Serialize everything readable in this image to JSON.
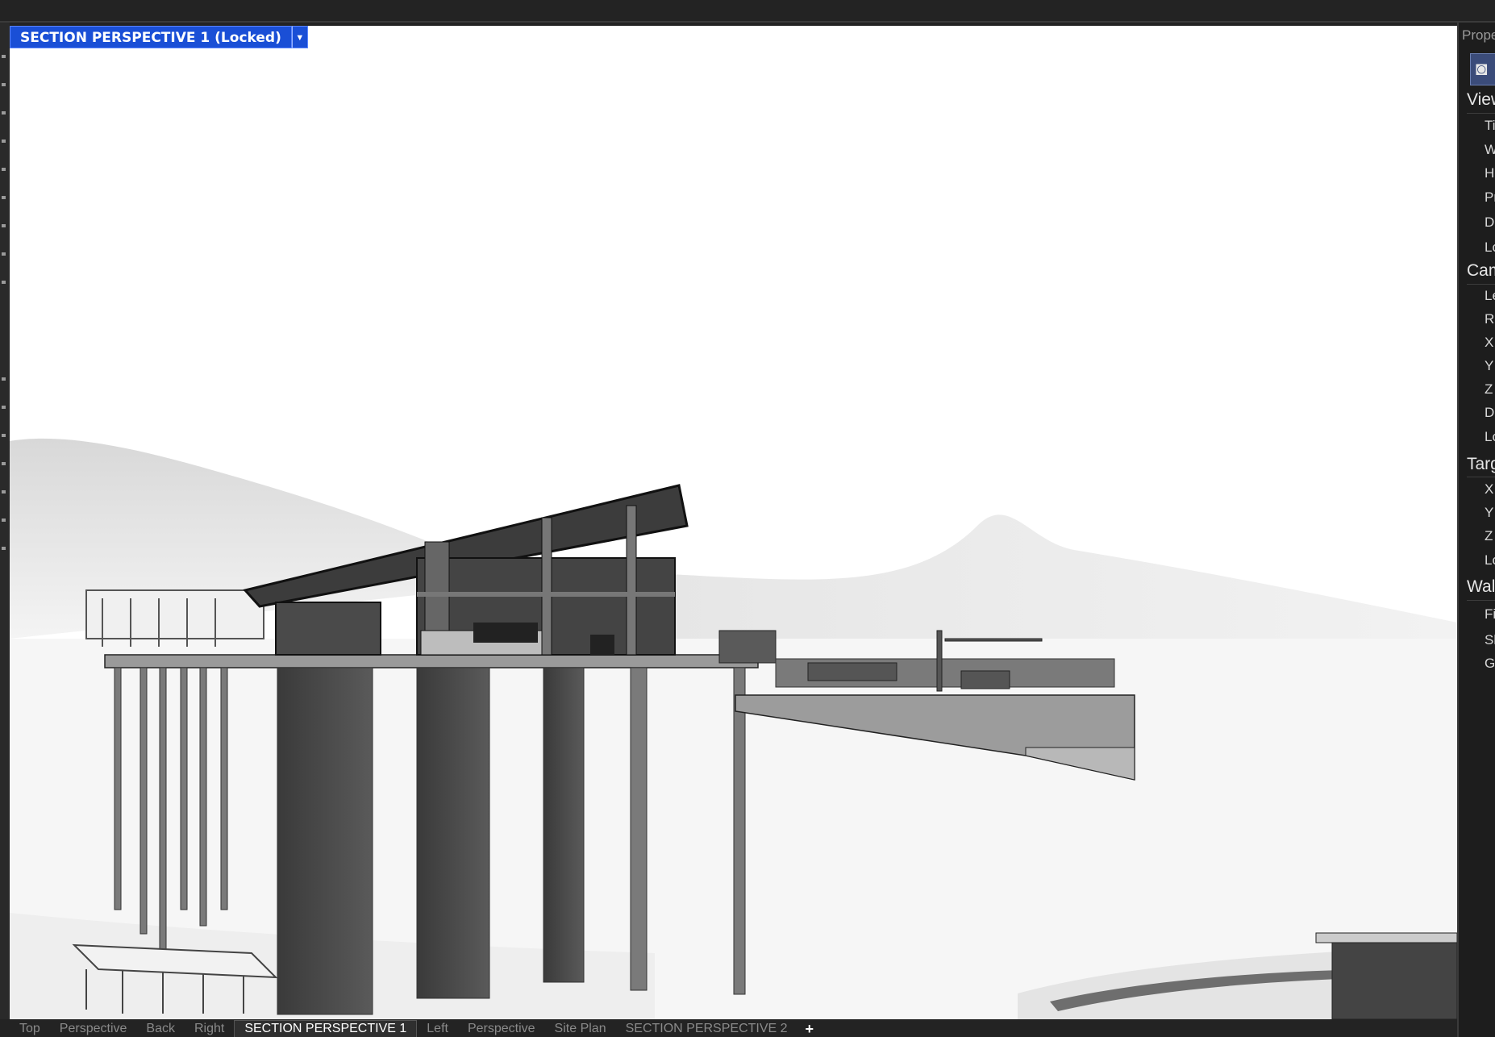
{
  "view": {
    "title": "SECTION PERSPECTIVE 1 (Locked)"
  },
  "tabs": [
    {
      "label": "Top",
      "active": false
    },
    {
      "label": "Perspective",
      "active": false
    },
    {
      "label": "Back",
      "active": false
    },
    {
      "label": "Right",
      "active": false
    },
    {
      "label": "SECTION PERSPECTIVE 1",
      "active": true
    },
    {
      "label": "Left",
      "active": false
    },
    {
      "label": "Perspective",
      "active": false
    },
    {
      "label": "Site Plan",
      "active": false
    },
    {
      "label": "SECTION PERSPECTIVE 2",
      "active": false
    }
  ],
  "add_tab_symbol": "+",
  "properties_panel": {
    "title": "Prope",
    "camera_icon": "camera-icon",
    "sections": [
      {
        "label": "View",
        "rows": [
          "Ti",
          "W",
          "H",
          "Pr",
          "D",
          "Lc"
        ]
      },
      {
        "label": "Cam",
        "rows": [
          "Le",
          "R",
          "X",
          "Y",
          "Z",
          "D",
          "Lc"
        ]
      },
      {
        "label": "Targ",
        "rows": [
          "X",
          "Y",
          "Z",
          "Lc"
        ]
      },
      {
        "label": "Wal",
        "rows": [
          "Fi",
          "Sl",
          "G"
        ]
      }
    ]
  },
  "colors": {
    "selected_title_bg": "#1a4fd6",
    "app_background": "#232323",
    "viewport_background": "#ffffff"
  }
}
